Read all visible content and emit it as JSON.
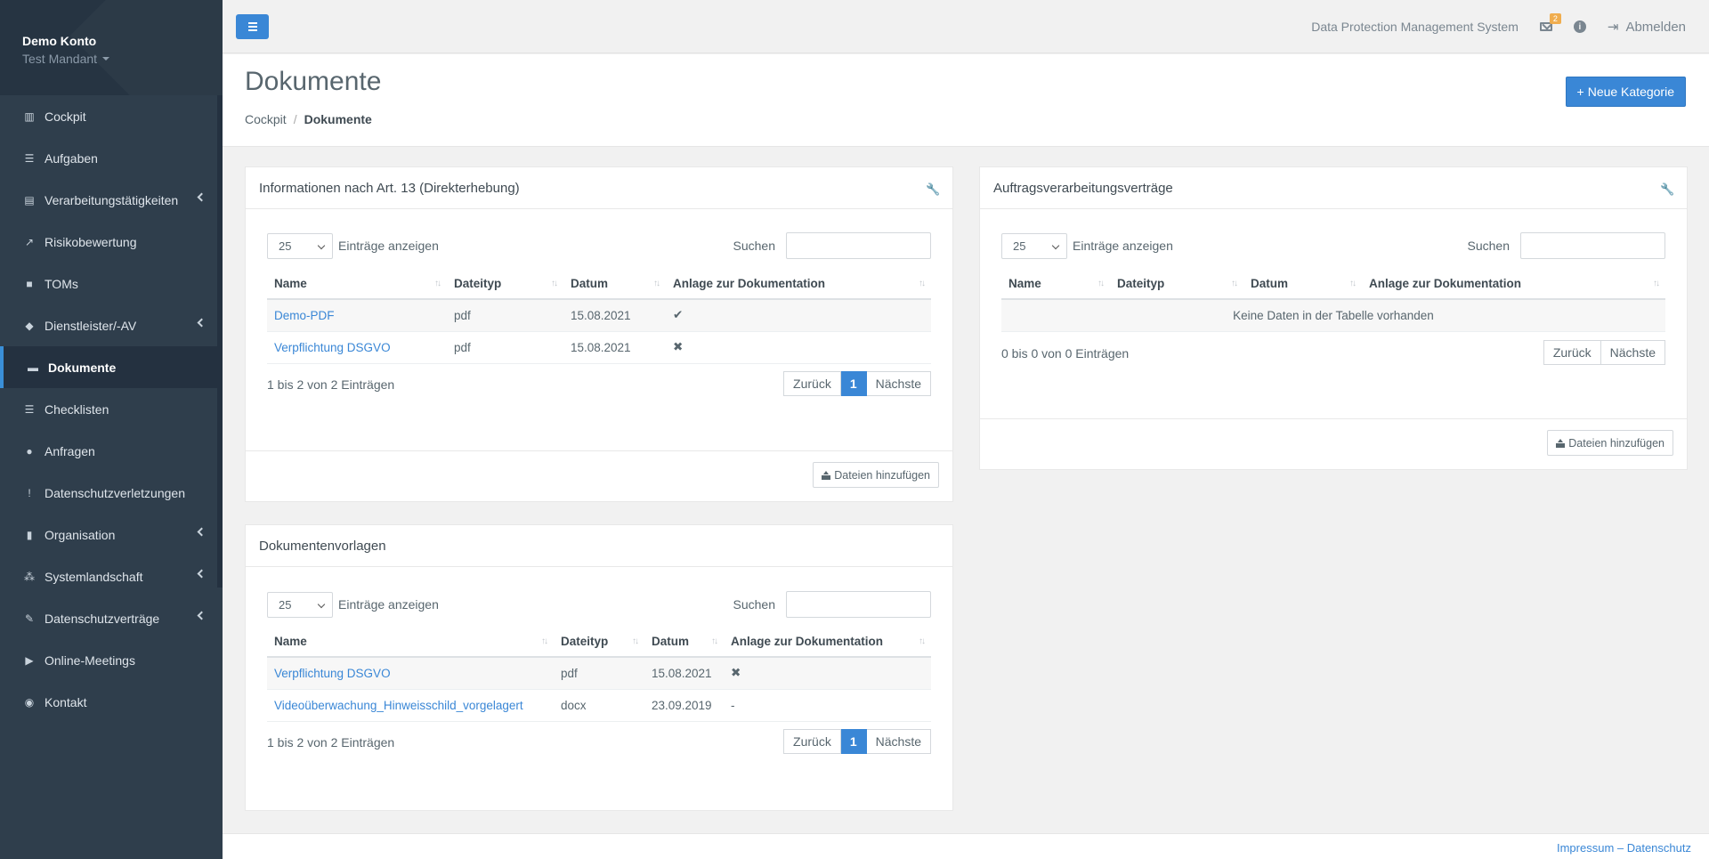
{
  "account": {
    "name": "Demo Konto",
    "tenant": "Test Mandant"
  },
  "nav": [
    {
      "label": "Cockpit",
      "icon": "chart-icon"
    },
    {
      "label": "Aufgaben",
      "icon": "list-icon"
    },
    {
      "label": "Verarbeitungstätigkeiten",
      "icon": "list-icon"
    },
    {
      "label": "Risikobewertung",
      "icon": "chart-icon"
    },
    {
      "label": "TOMs",
      "icon": "lock-icon"
    },
    {
      "label": "Dienstleister/-AV",
      "icon": "handshake-icon"
    },
    {
      "label": "Dokumente",
      "icon": "folder-icon"
    },
    {
      "label": "Checklisten",
      "icon": "list-icon"
    },
    {
      "label": "Anfragen",
      "icon": "comments-icon"
    },
    {
      "label": "Datenschutzverletzungen",
      "icon": "exclamation-icon"
    },
    {
      "label": "Organisation",
      "icon": "building-icon"
    },
    {
      "label": "Systemlandschaft",
      "icon": "network-icon"
    },
    {
      "label": "Datenschutzverträge",
      "icon": "contract-icon"
    },
    {
      "label": "Online-Meetings",
      "icon": "video-icon"
    },
    {
      "label": "Kontakt",
      "icon": "globe-icon"
    }
  ],
  "topbar": {
    "system_name": "Data Protection Management System",
    "badge": "2",
    "logout": "Abmelden"
  },
  "page": {
    "title": "Dokumente",
    "breadcrumb_home": "Cockpit",
    "breadcrumb_current": "Dokumente",
    "new_category": "Neue Kategorie"
  },
  "common": {
    "page_size": "25",
    "show_entries": "Einträge anzeigen",
    "search": "Suchen",
    "prev": "Zurück",
    "next": "Nächste",
    "page": "1",
    "upload": "Dateien hinzufügen",
    "col_name": "Name",
    "col_type": "Dateityp",
    "col_date": "Datum",
    "col_attach": "Anlage zur Dokumentation"
  },
  "panel1": {
    "title": "Informationen nach Art. 13 (Direkterhebung)",
    "rows": [
      {
        "name": "Demo-PDF",
        "type": "pdf",
        "date": "15.08.2021",
        "attach": "✔"
      },
      {
        "name": "Verpflichtung DSGVO",
        "type": "pdf",
        "date": "15.08.2021",
        "attach": "✖"
      }
    ],
    "info": "1 bis 2 von 2 Einträgen"
  },
  "panel2": {
    "title": "Auftragsverarbeitungsverträge",
    "empty": "Keine Daten in der Tabelle vorhanden",
    "info": "0 bis 0 von 0 Einträgen"
  },
  "panel3": {
    "title": "Dokumentenvorlagen",
    "rows": [
      {
        "name": "Verpflichtung DSGVO",
        "type": "pdf",
        "date": "15.08.2021",
        "attach": "✖"
      },
      {
        "name": "Videoüberwachung_Hinweisschild_vorgelagert",
        "type": "docx",
        "date": "23.09.2019",
        "attach": "-"
      }
    ],
    "info": "1 bis 2 von 2 Einträgen"
  },
  "footer": {
    "links": "Impressum – Datenschutz"
  }
}
